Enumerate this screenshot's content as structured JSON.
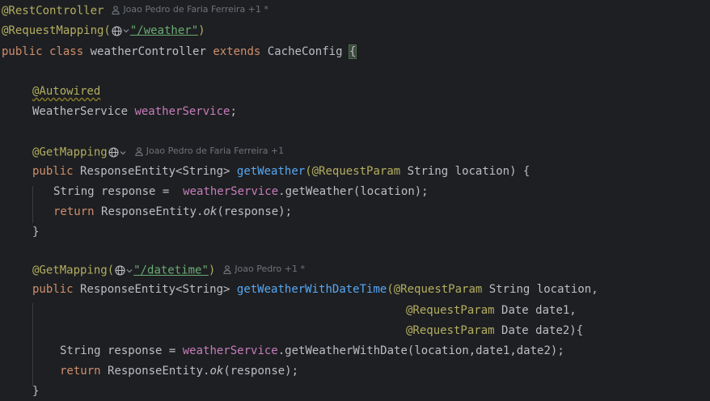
{
  "code": {
    "class_annotation": "@RestController",
    "class_annotation_author": "Joao Pedro de Faria Ferreira +1 *",
    "request_mapping_prefix": "@RequestMapping(",
    "request_mapping_path": "\"/weather\"",
    "request_mapping_suffix": ")",
    "class_decl_public": "public",
    "class_decl_class": "class",
    "class_name": "weatherController",
    "class_decl_extends": "extends",
    "class_parent": "CacheConfig",
    "class_open_brace": "{",
    "autowired": "@Autowired",
    "field_type": "WeatherService",
    "field_name": "weatherService",
    "field_semicolon": ";",
    "getmapping1": "@GetMapping",
    "getmapping1_author": "Joao Pedro de Faria Ferreira +1",
    "m1_public": "public",
    "m1_return": "ResponseEntity<String>",
    "m1_name": "getWeather",
    "m1_param_annotation": "(@RequestParam",
    "m1_params": "String location) {",
    "m1_body1_type": "String response =",
    "m1_body1_field": "weatherService",
    "m1_body1_rest": ".getWeather(location);",
    "m1_body2_return": "return",
    "m1_body2_class": "ResponseEntity.",
    "m1_body2_ok": "ok",
    "m1_body2_rest": "(response);",
    "m1_close": "}",
    "getmapping2_prefix": "@GetMapping(",
    "getmapping2_path": "\"/datetime\"",
    "getmapping2_suffix": ")",
    "getmapping2_author": "Joao Pedro +1 *",
    "m2_public": "public",
    "m2_return": "ResponseEntity<String>",
    "m2_name": "getWeatherWithDateTime",
    "m2_param1_annotation": "(@RequestParam",
    "m2_param1_rest": "String location,",
    "m2_param2_annotation": "@RequestParam",
    "m2_param2_rest": "Date date1,",
    "m2_param3_annotation": "@RequestParam",
    "m2_param3_rest": "Date date2){",
    "m2_body1_type": "String response =",
    "m2_body1_field": "weatherService",
    "m2_body1_rest": ".getWeatherWithDate(location,date1,date2);",
    "m2_body2_return": "return",
    "m2_body2_class": "ResponseEntity.",
    "m2_body2_ok": "ok",
    "m2_body2_rest": "(response);",
    "m2_close": "}"
  },
  "colors": {
    "background": "#1e1f22",
    "keyword": "#cf8e6d",
    "annotation": "#b3ae60",
    "method": "#56a8f5",
    "field": "#c77dbb",
    "string": "#6aab73",
    "text": "#bcbec4",
    "hint": "#6f737a"
  },
  "icons": [
    "person-icon",
    "globe-icon",
    "chevron-down-icon"
  ]
}
